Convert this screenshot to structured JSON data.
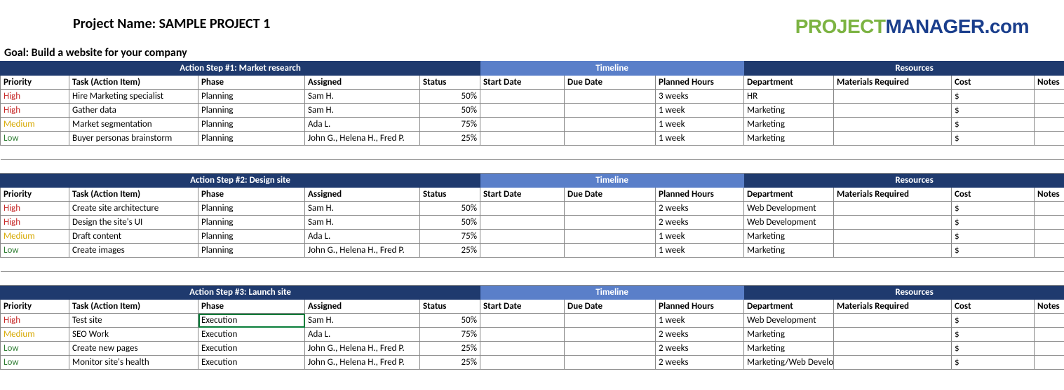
{
  "header": {
    "project_label": "Project Name: SAMPLE PROJECT 1",
    "goal": "Goal: Build a website for your company",
    "logo": {
      "part1": "PROJECT",
      "part2": "MANAGER",
      "part3": ".com"
    }
  },
  "columns": {
    "priority": "Priority",
    "task": "Task (Action Item)",
    "phase": "Phase",
    "assigned": "Assigned",
    "status": "Status",
    "start": "Start Date",
    "due": "Due Date",
    "planned": "Planned Hours",
    "dept": "Department",
    "materials": "Materials Required",
    "cost": "Cost",
    "notes": "Notes"
  },
  "section_labels": {
    "timeline": "Timeline",
    "resources": "Resources"
  },
  "sections": [
    {
      "title": "Action Step #1: Market research",
      "rows": [
        {
          "priority": "High",
          "pclass": "pr-high",
          "task": "Hire Marketing specialist",
          "phase": "Planning",
          "assigned": "Sam H.",
          "status": "50%",
          "start": "",
          "due": "",
          "planned": "3 weeks",
          "dept": "HR",
          "materials": "",
          "cost": "$",
          "notes": ""
        },
        {
          "priority": "High",
          "pclass": "pr-high",
          "task": "Gather data",
          "phase": "Planning",
          "assigned": "Sam H.",
          "status": "50%",
          "start": "",
          "due": "",
          "planned": "1 week",
          "dept": "Marketing",
          "materials": "",
          "cost": "$",
          "notes": ""
        },
        {
          "priority": "Medium",
          "pclass": "pr-med",
          "task": "Market segmentation",
          "phase": "Planning",
          "assigned": "Ada L.",
          "status": "75%",
          "start": "",
          "due": "",
          "planned": "1 week",
          "dept": "Marketing",
          "materials": "",
          "cost": "$",
          "notes": ""
        },
        {
          "priority": "Low",
          "pclass": "pr-low",
          "task": "Buyer personas brainstorm",
          "phase": "Planning",
          "assigned": "John G., Helena H., Fred P.",
          "status": "25%",
          "start": "",
          "due": "",
          "planned": "1 week",
          "dept": "Marketing",
          "materials": "",
          "cost": "$",
          "notes": ""
        }
      ]
    },
    {
      "title": "Action Step #2: Design site",
      "rows": [
        {
          "priority": "High",
          "pclass": "pr-high",
          "task": "Create site architecture",
          "phase": "Planning",
          "assigned": "Sam H.",
          "status": "50%",
          "start": "",
          "due": "",
          "planned": "2 weeks",
          "dept": "Web Development",
          "materials": "",
          "cost": "$",
          "notes": ""
        },
        {
          "priority": "High",
          "pclass": "pr-high",
          "task": "Design the site's UI",
          "phase": "Planning",
          "assigned": "Sam H.",
          "status": "50%",
          "start": "",
          "due": "",
          "planned": "2 weeks",
          "dept": "Web Development",
          "materials": "",
          "cost": "$",
          "notes": ""
        },
        {
          "priority": "Medium",
          "pclass": "pr-med",
          "task": "Draft content",
          "phase": "Planning",
          "assigned": "Ada L.",
          "status": "75%",
          "start": "",
          "due": "",
          "planned": "1 week",
          "dept": "Marketing",
          "materials": "",
          "cost": "$",
          "notes": ""
        },
        {
          "priority": "Low",
          "pclass": "pr-low",
          "task": "Create images",
          "phase": "Planning",
          "assigned": "John G., Helena H., Fred P.",
          "status": "25%",
          "start": "",
          "due": "",
          "planned": "1 week",
          "dept": "Marketing",
          "materials": "",
          "cost": "$",
          "notes": ""
        }
      ]
    },
    {
      "title": "Action Step #3: Launch site",
      "rows": [
        {
          "priority": "High",
          "pclass": "pr-high",
          "task": "Test site",
          "phase": "Execution",
          "assigned": "Sam H.",
          "status": "50%",
          "start": "",
          "due": "",
          "planned": "1 week",
          "dept": "Web Development",
          "materials": "",
          "cost": "$",
          "notes": "",
          "selected": true
        },
        {
          "priority": "Medium",
          "pclass": "pr-med",
          "task": "SEO Work",
          "phase": "Execution",
          "assigned": "Ada L.",
          "status": "75%",
          "start": "",
          "due": "",
          "planned": "2 weeks",
          "dept": "Marketing",
          "materials": "",
          "cost": "$",
          "notes": ""
        },
        {
          "priority": "Low",
          "pclass": "pr-low",
          "task": "Create new pages",
          "phase": "Execution",
          "assigned": "John G., Helena H., Fred P.",
          "status": "25%",
          "start": "",
          "due": "",
          "planned": "2 weeks",
          "dept": "Marketing",
          "materials": "",
          "cost": "$",
          "notes": ""
        },
        {
          "priority": "Low",
          "pclass": "pr-low",
          "task": "Monitor site's health",
          "phase": "Execution",
          "assigned": "John G., Helena H., Fred P.",
          "status": "25%",
          "start": "",
          "due": "",
          "planned": "2 weeks",
          "dept": "Marketing/Web Development",
          "materials": "",
          "cost": "$",
          "notes": ""
        }
      ]
    }
  ]
}
